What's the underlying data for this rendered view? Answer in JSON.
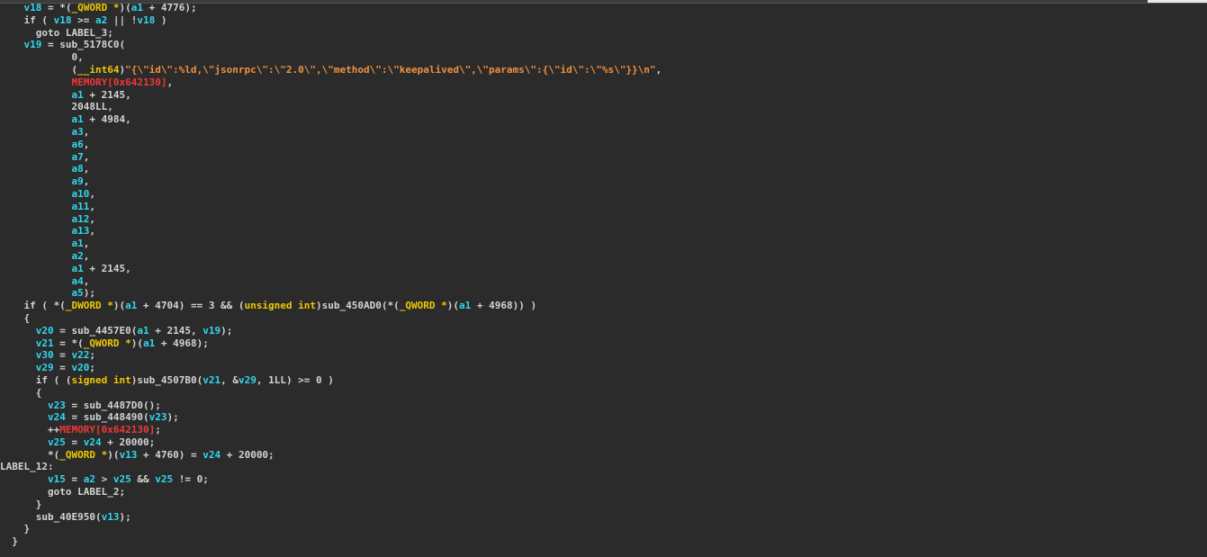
{
  "lines": [
    [
      [
        "    ",
        "plain"
      ],
      [
        "v18",
        "var"
      ],
      [
        " = *(",
        "plain"
      ],
      [
        "_QWORD *",
        "type"
      ],
      [
        ")(",
        "plain"
      ],
      [
        "a1",
        "var"
      ],
      [
        " + 4776);",
        "plain"
      ]
    ],
    [
      [
        "    if ( ",
        "plain"
      ],
      [
        "v18",
        "var"
      ],
      [
        " >= ",
        "plain"
      ],
      [
        "a2",
        "var"
      ],
      [
        " || !",
        "plain"
      ],
      [
        "v18",
        "var"
      ],
      [
        " )",
        "plain"
      ]
    ],
    [
      [
        "      goto LABEL_3;",
        "plain"
      ]
    ],
    [
      [
        "    ",
        "plain"
      ],
      [
        "v19",
        "var"
      ],
      [
        " = sub_5178C0(",
        "plain"
      ]
    ],
    [
      [
        "            0,",
        "plain"
      ]
    ],
    [
      [
        "            (",
        "plain"
      ],
      [
        "__int64",
        "type"
      ],
      [
        ")",
        "plain"
      ],
      [
        "\"{\\\"id\\\":%ld,\\\"jsonrpc\\\":\\\"2.0\\\",\\\"method\\\":\\\"keepalived\\\",\\\"params\\\":{\\\"id\\\":\\\"%s\\\"}}\\n\"",
        "str"
      ],
      [
        ",",
        "plain"
      ]
    ],
    [
      [
        "            ",
        "plain"
      ],
      [
        "MEMORY[0x642130]",
        "mem"
      ],
      [
        ",",
        "plain"
      ]
    ],
    [
      [
        "            ",
        "plain"
      ],
      [
        "a1",
        "var"
      ],
      [
        " + 2145,",
        "plain"
      ]
    ],
    [
      [
        "            2048LL,",
        "plain"
      ]
    ],
    [
      [
        "            ",
        "plain"
      ],
      [
        "a1",
        "var"
      ],
      [
        " + 4984,",
        "plain"
      ]
    ],
    [
      [
        "            ",
        "plain"
      ],
      [
        "a3",
        "var"
      ],
      [
        ",",
        "plain"
      ]
    ],
    [
      [
        "            ",
        "plain"
      ],
      [
        "a6",
        "var"
      ],
      [
        ",",
        "plain"
      ]
    ],
    [
      [
        "            ",
        "plain"
      ],
      [
        "a7",
        "var"
      ],
      [
        ",",
        "plain"
      ]
    ],
    [
      [
        "            ",
        "plain"
      ],
      [
        "a8",
        "var"
      ],
      [
        ",",
        "plain"
      ]
    ],
    [
      [
        "            ",
        "plain"
      ],
      [
        "a9",
        "var"
      ],
      [
        ",",
        "plain"
      ]
    ],
    [
      [
        "            ",
        "plain"
      ],
      [
        "a10",
        "var"
      ],
      [
        ",",
        "plain"
      ]
    ],
    [
      [
        "            ",
        "plain"
      ],
      [
        "a11",
        "var"
      ],
      [
        ",",
        "plain"
      ]
    ],
    [
      [
        "            ",
        "plain"
      ],
      [
        "a12",
        "var"
      ],
      [
        ",",
        "plain"
      ]
    ],
    [
      [
        "            ",
        "plain"
      ],
      [
        "a13",
        "var"
      ],
      [
        ",",
        "plain"
      ]
    ],
    [
      [
        "            ",
        "plain"
      ],
      [
        "a1",
        "var"
      ],
      [
        ",",
        "plain"
      ]
    ],
    [
      [
        "            ",
        "plain"
      ],
      [
        "a2",
        "var"
      ],
      [
        ",",
        "plain"
      ]
    ],
    [
      [
        "            ",
        "plain"
      ],
      [
        "a1",
        "var"
      ],
      [
        " + 2145,",
        "plain"
      ]
    ],
    [
      [
        "            ",
        "plain"
      ],
      [
        "a4",
        "var"
      ],
      [
        ",",
        "plain"
      ]
    ],
    [
      [
        "            ",
        "plain"
      ],
      [
        "a5",
        "var"
      ],
      [
        ");",
        "plain"
      ]
    ],
    [
      [
        "    if ( *(",
        "plain"
      ],
      [
        "_DWORD *",
        "type"
      ],
      [
        ")(",
        "plain"
      ],
      [
        "a1",
        "var"
      ],
      [
        " + 4704) == 3 && (",
        "plain"
      ],
      [
        "unsigned int",
        "type"
      ],
      [
        ")sub_450AD0(*(",
        "plain"
      ],
      [
        "_QWORD *",
        "type"
      ],
      [
        ")(",
        "plain"
      ],
      [
        "a1",
        "var"
      ],
      [
        " + 4968)) )",
        "plain"
      ]
    ],
    [
      [
        "    {",
        "plain"
      ]
    ],
    [
      [
        "      ",
        "plain"
      ],
      [
        "v20",
        "var"
      ],
      [
        " = sub_4457E0(",
        "plain"
      ],
      [
        "a1",
        "var"
      ],
      [
        " + 2145, ",
        "plain"
      ],
      [
        "v19",
        "var"
      ],
      [
        ");",
        "plain"
      ]
    ],
    [
      [
        "      ",
        "plain"
      ],
      [
        "v21",
        "var"
      ],
      [
        " = *(",
        "plain"
      ],
      [
        "_QWORD *",
        "type"
      ],
      [
        ")(",
        "plain"
      ],
      [
        "a1",
        "var"
      ],
      [
        " + 4968);",
        "plain"
      ]
    ],
    [
      [
        "      ",
        "plain"
      ],
      [
        "v30",
        "var"
      ],
      [
        " = ",
        "plain"
      ],
      [
        "v22",
        "var"
      ],
      [
        ";",
        "plain"
      ]
    ],
    [
      [
        "      ",
        "plain"
      ],
      [
        "v29",
        "var"
      ],
      [
        " = ",
        "plain"
      ],
      [
        "v20",
        "var"
      ],
      [
        ";",
        "plain"
      ]
    ],
    [
      [
        "      if ( (",
        "plain"
      ],
      [
        "signed int",
        "type"
      ],
      [
        ")sub_4507B0(",
        "plain"
      ],
      [
        "v21",
        "var"
      ],
      [
        ", &",
        "plain"
      ],
      [
        "v29",
        "var"
      ],
      [
        ", 1LL) >= 0 )",
        "plain"
      ]
    ],
    [
      [
        "      {",
        "plain"
      ]
    ],
    [
      [
        "        ",
        "plain"
      ],
      [
        "v23",
        "var"
      ],
      [
        " = sub_4487D0();",
        "plain"
      ]
    ],
    [
      [
        "        ",
        "plain"
      ],
      [
        "v24",
        "var"
      ],
      [
        " = sub_448490(",
        "plain"
      ],
      [
        "v23",
        "var"
      ],
      [
        ");",
        "plain"
      ]
    ],
    [
      [
        "        ++",
        "plain"
      ],
      [
        "MEMORY[0x642130]",
        "mem"
      ],
      [
        ";",
        "plain"
      ]
    ],
    [
      [
        "        ",
        "plain"
      ],
      [
        "v25",
        "var"
      ],
      [
        " = ",
        "plain"
      ],
      [
        "v24",
        "var"
      ],
      [
        " + 20000;",
        "plain"
      ]
    ],
    [
      [
        "        *(",
        "plain"
      ],
      [
        "_QWORD *",
        "type"
      ],
      [
        ")(",
        "plain"
      ],
      [
        "v13",
        "var"
      ],
      [
        " + 4760) = ",
        "plain"
      ],
      [
        "v24",
        "var"
      ],
      [
        " + 20000;",
        "plain"
      ]
    ],
    [
      [
        "LABEL_12:",
        "label"
      ]
    ],
    [
      [
        "        ",
        "plain"
      ],
      [
        "v15",
        "var"
      ],
      [
        " = ",
        "plain"
      ],
      [
        "a2",
        "var"
      ],
      [
        " > ",
        "plain"
      ],
      [
        "v25",
        "var"
      ],
      [
        " && ",
        "plain"
      ],
      [
        "v25",
        "var"
      ],
      [
        " != 0;",
        "plain"
      ]
    ],
    [
      [
        "        goto LABEL_2;",
        "plain"
      ]
    ],
    [
      [
        "      }",
        "plain"
      ]
    ],
    [
      [
        "      sub_40E950(",
        "plain"
      ],
      [
        "v13",
        "var"
      ],
      [
        ");",
        "plain"
      ]
    ],
    [
      [
        "    }",
        "plain"
      ]
    ],
    [
      [
        "  }",
        "plain"
      ]
    ]
  ]
}
